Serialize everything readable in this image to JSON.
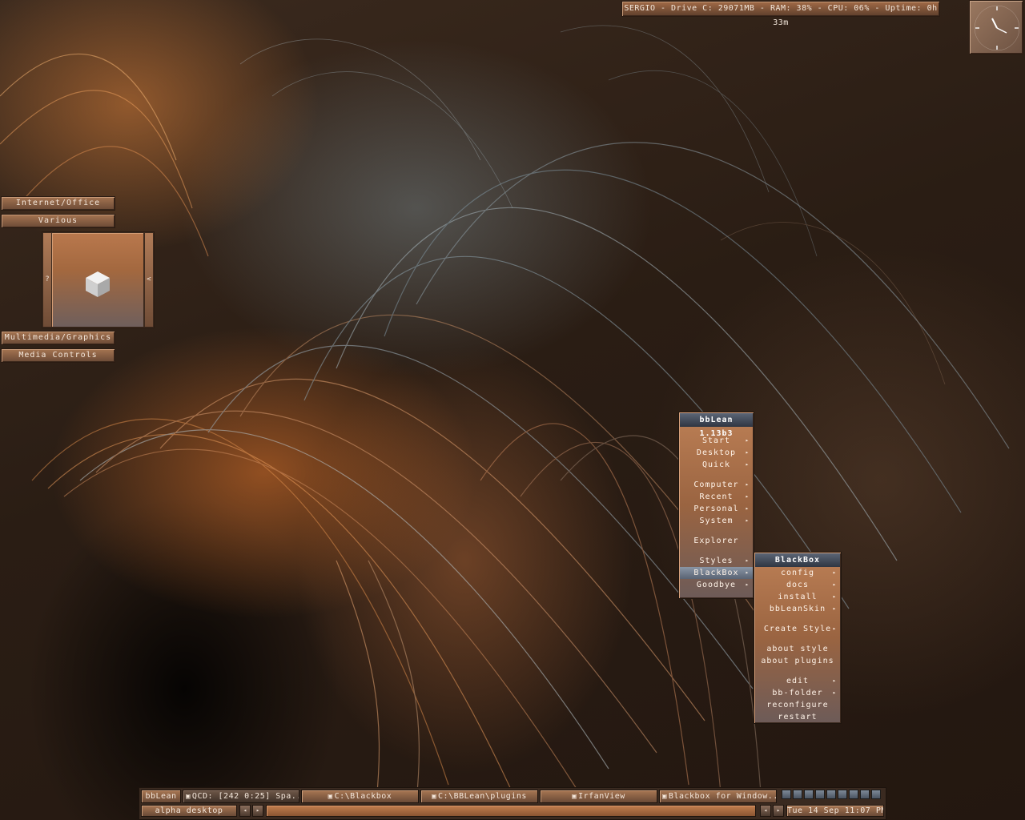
{
  "sysbar": {
    "text": "SERGIO - Drive C: 29071MB - RAM: 38% - CPU: 06% - Uptime: 0h 33m"
  },
  "launcher": {
    "buttons": [
      "Internet/Office",
      "Various",
      "Multimedia/Graphics",
      "Media Controls"
    ],
    "panel_left": "?",
    "panel_right": "<"
  },
  "main_menu": {
    "title": "bbLean 1.13b3",
    "items": [
      "Start",
      "Desktop",
      "Quick",
      "Computer",
      "Recent",
      "Personal",
      "System",
      "Explorer",
      "Styles",
      "BlackBox",
      "Goodbye"
    ],
    "active": "BlackBox"
  },
  "sub_menu": {
    "title": "BlackBox",
    "items": [
      "config",
      "docs",
      "install",
      "bbLeanSkin",
      "Create Style",
      "about style",
      "about plugins",
      "edit",
      "bb-folder",
      "reconfigure",
      "restart"
    ]
  },
  "taskbar": {
    "label": "bbLean",
    "tasks": [
      "QCD: [242 0:25] Spa...",
      "C:\\Blackbox",
      "C:\\BBLean\\plugins",
      "IrfanView",
      "Blackbox for Window..."
    ],
    "workspace": "alpha desktop",
    "clock": "Tue 14 Sep 11:07 PM"
  },
  "icons": {
    "menu_arrow": "▸",
    "nav_left": "◂",
    "nav_right": "▸",
    "task_icon": "▣",
    "tray": [
      "tray-1",
      "tray-2",
      "tray-3",
      "tray-4",
      "tray-5",
      "tray-6",
      "tray-7",
      "tray-8",
      "tray-9"
    ]
  },
  "colors": {
    "accent": "#a9714b",
    "title_bar": "#3f4756",
    "highlight": "#6f7a8b"
  }
}
